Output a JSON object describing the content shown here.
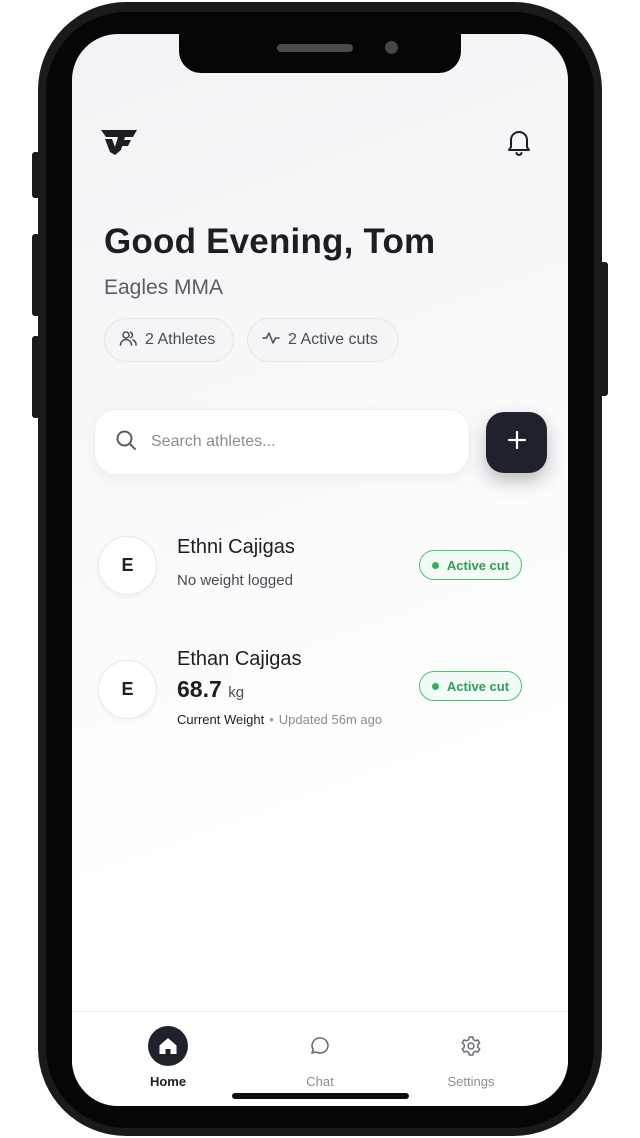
{
  "header": {
    "logo_icon": "brand-logo-icon",
    "notification_icon": "bell-icon"
  },
  "greeting": {
    "title": "Good Evening, Tom",
    "team": "Eagles MMA"
  },
  "stats": {
    "athletes": "2 Athletes",
    "athletes_icon": "users-icon",
    "active_cuts": "2 Active cuts",
    "active_cuts_icon": "activity-icon"
  },
  "search": {
    "placeholder": "Search athletes...",
    "value": ""
  },
  "add_button": {
    "icon": "plus-icon"
  },
  "athletes": [
    {
      "initial": "E",
      "name": "Ethni Cajigas",
      "status_text": "No weight logged",
      "badge": "Active cut"
    },
    {
      "initial": "E",
      "name": "Ethan Cajigas",
      "weight_value": "68.7",
      "weight_unit": "kg",
      "weight_label": "Current Weight",
      "separator": "•",
      "updated": "Updated 56m ago",
      "badge": "Active cut"
    }
  ],
  "tabbar": {
    "items": [
      {
        "label": "Home",
        "icon": "home-icon",
        "active": true
      },
      {
        "label": "Chat",
        "icon": "chat-bubble-icon",
        "active": false
      },
      {
        "label": "Settings",
        "icon": "gear-icon",
        "active": false
      }
    ]
  },
  "colors": {
    "accent_dark": "#1f222b",
    "badge_green": "#2f9e58",
    "badge_border": "#47c472"
  }
}
